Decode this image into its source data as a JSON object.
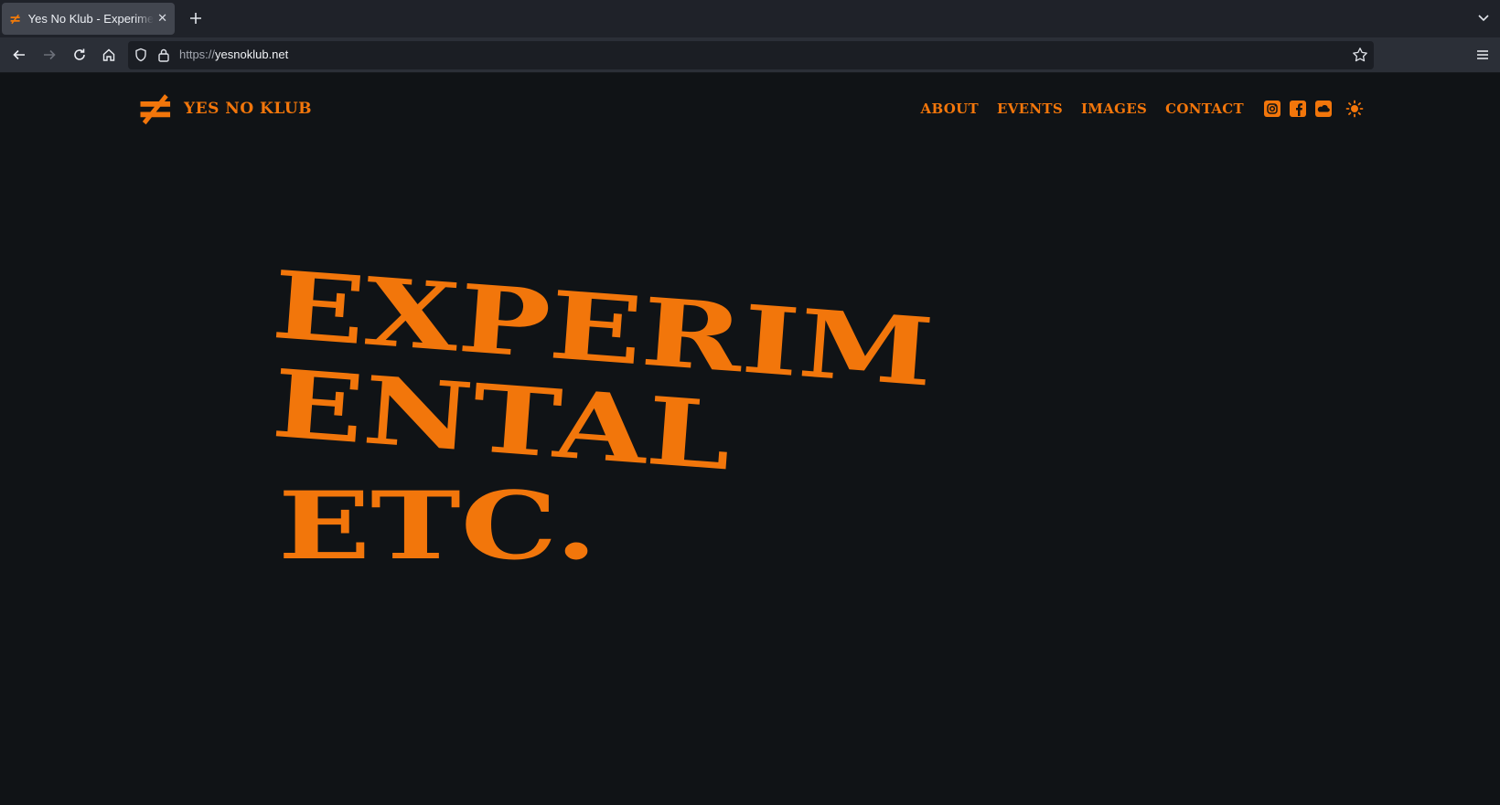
{
  "browser": {
    "tab_title": "Yes No Klub - Experimental etc.",
    "tab_favicon": "≠",
    "url_protocol": "https://",
    "url_host": "yesnoklub.net",
    "icons": [
      "back-icon",
      "forward-icon",
      "reload-icon",
      "home-icon",
      "shield-icon",
      "lock-icon",
      "star-icon",
      "menu-icon",
      "tab-list-icon",
      "close-icon",
      "plus-icon"
    ]
  },
  "site": {
    "logo": "≠",
    "name": "YES NO KLUB",
    "nav": [
      "ABOUT",
      "EVENTS",
      "IMAGES",
      "CONTACT"
    ],
    "social_icons": [
      "instagram-icon",
      "facebook-icon",
      "soundcloud-icon"
    ],
    "theme_icon": "sun-icon",
    "accent_color": "#f2760b",
    "background_color": "#101316",
    "hero": {
      "line1": "EXPERIM",
      "line2": "ENTAL",
      "line3": "ETC."
    }
  }
}
